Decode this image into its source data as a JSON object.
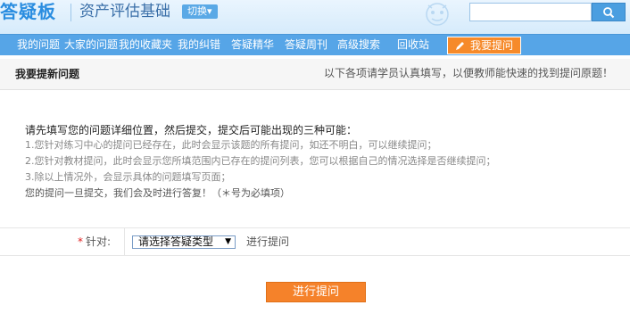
{
  "header": {
    "logo_text": "答疑板",
    "site_title": "资产评估基础",
    "switch_label": "切换▾",
    "search": {
      "value": "",
      "placeholder": ""
    },
    "icons": {
      "search": "search-icon",
      "mascot": "mascot-illustration"
    }
  },
  "nav": {
    "items": [
      {
        "label": "我的问题"
      },
      {
        "label": "大家的问题"
      },
      {
        "label": "我的收藏夹"
      },
      {
        "label": "我的纠错"
      },
      {
        "label": "答疑精华"
      },
      {
        "label": "答疑周刊"
      },
      {
        "label": "高级搜索"
      },
      {
        "label": "回收站"
      }
    ],
    "ask_button": {
      "label": "我要提问",
      "icon": "pencil-icon"
    }
  },
  "section": {
    "title": "我要提新问题",
    "hint": "以下各项请学员认真填写，以便教师能快速的找到提问原题！"
  },
  "instructions": {
    "intro": "请先填写您的问题详细位置，然后提交，提交后可能出现的三种可能：",
    "items": [
      "1.您针对练习中心的提问已经存在，此时会显示该题的所有提问，如还不明白，可以继续提问；",
      "2.您针对教材提问，此时会显示您所填范围内已存在的提问列表，您可以根据自己的情况选择是否继续提问；",
      "3.除以上情况外，会显示具体的问题填写页面；"
    ],
    "note": "您的提问一旦提交，我们会及时进行答复！（＊号为必填项）"
  },
  "form": {
    "required_mark": "*",
    "label": "针对:",
    "select_value": "请选择答疑类型",
    "after_text": "进行提问"
  },
  "submit_label": "进行提问",
  "colors": {
    "nav_bg": "#56a5e7",
    "accent_orange": "#f5822a",
    "logo_blue": "#2a8de0"
  }
}
